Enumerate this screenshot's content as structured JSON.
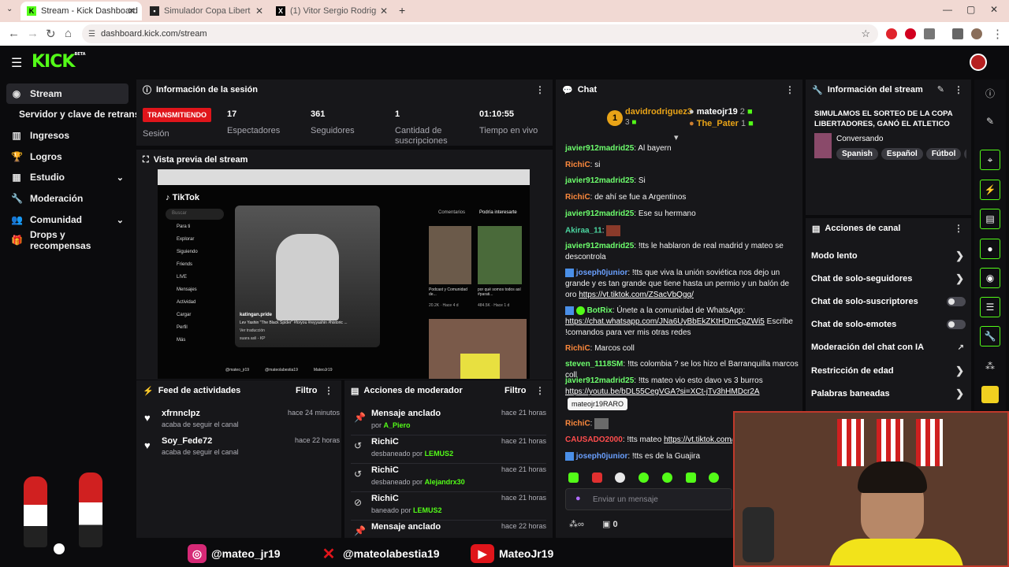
{
  "browser": {
    "tabs": [
      {
        "title": "Stream - Kick Dashboard",
        "active": true
      },
      {
        "title": "Simulador Copa Libertadores 2...",
        "active": false
      },
      {
        "title": "(1) Vitor Sergio Rodrigues VSR...",
        "active": false
      }
    ],
    "url": "dashboard.kick.com/stream"
  },
  "brand": {
    "logo": "KICK",
    "beta": "BETA",
    "accent": "#53fc18"
  },
  "sidebar": {
    "items": [
      {
        "label": "Stream",
        "icon": "broadcast-icon"
      },
      {
        "label": "Servidor y clave de retransm",
        "icon": ""
      },
      {
        "label": "Ingresos",
        "icon": "chart-icon"
      },
      {
        "label": "Logros",
        "icon": "trophy-icon"
      },
      {
        "label": "Estudio",
        "icon": "grid-icon"
      },
      {
        "label": "Moderación",
        "icon": "wrench-icon"
      },
      {
        "label": "Comunidad",
        "icon": "people-icon"
      },
      {
        "label": "Drops y recompensas",
        "icon": "gift-icon"
      }
    ]
  },
  "session": {
    "title": "Información de la sesión",
    "badge": "TRANSMITIENDO",
    "badge_label": "Sesión",
    "stats": [
      {
        "value": "17",
        "label": "Espectadores"
      },
      {
        "value": "361",
        "label": "Seguidores"
      },
      {
        "value": "1",
        "label": "Cantidad de suscripciones"
      },
      {
        "value": "01:10:55",
        "label": "Tiempo en vivo"
      }
    ]
  },
  "preview": {
    "title": "Vista previa del stream",
    "tiktok_brand": "TikTok",
    "tiktok_search": "Buscar",
    "tiktok_menu": [
      "Para ti",
      "Explorar",
      "Siguiendo",
      "Friends",
      "LIVE",
      "Mensajes",
      "Actividad",
      "Cargar",
      "Perfil",
      "Más"
    ],
    "tiktok_tabs": [
      "Comentarios",
      "Podría interesarte"
    ],
    "video_user": "katingan.pride",
    "video_caption": "Lev Yashin \"The Black Spider\" #foryou #reyyashin #historic ...",
    "video_translate": "Ver traducción",
    "video_sound": "suara asli - KP",
    "cards": [
      {
        "caption": "Podcast y Comunidad de...",
        "meta": "20.2K · Hace 4 d"
      },
      {
        "caption": "por qué somos todos así #parati...",
        "meta": "484.5K · Hace 1 d"
      }
    ],
    "overlay_handles": [
      "@mateo_jr19",
      "@mateolabestia19",
      "MateoJr19"
    ]
  },
  "feed": {
    "title": "Feed de actividades",
    "filter": "Filtro",
    "items": [
      {
        "user": "xfrnnclpz",
        "action": "acaba de seguir el canal",
        "time": "hace 24 minutos"
      },
      {
        "user": "Soy_Fede72",
        "action": "acaba de seguir el canal",
        "time": "hace 22 horas"
      }
    ]
  },
  "modactions": {
    "title": "Acciones de moderador",
    "filter": "Filtro",
    "items": [
      {
        "title": "Mensaje anclado",
        "prefix": "por ",
        "by": "A_Piero",
        "suffix": "",
        "time": "hace 21 horas",
        "icon": "pin-icon"
      },
      {
        "title": "RichiC",
        "prefix": "desbaneado por ",
        "by": "LEMUS2",
        "suffix": "",
        "time": "hace 21 horas",
        "icon": "undo-icon"
      },
      {
        "title": "RichiC",
        "prefix": "desbaneado por ",
        "by": "Alejandrx30",
        "suffix": "",
        "time": "hace 21 horas",
        "icon": "undo-icon"
      },
      {
        "title": "RichiC",
        "prefix": "baneado por ",
        "by": "LEMUS2",
        "suffix": "",
        "time": "hace 21 horas",
        "icon": "ban-icon"
      },
      {
        "title": "Mensaje anclado",
        "prefix": "",
        "by": "",
        "suffix": "",
        "time": "hace 22 horas",
        "icon": "pin-icon"
      }
    ]
  },
  "chat": {
    "title": "Chat",
    "top_gifters": [
      {
        "name": "davidrodriguez3",
        "count": "3",
        "rank": "1"
      },
      {
        "name": "mateojr19",
        "count": "2"
      },
      {
        "name": "The_Pater",
        "count": "1"
      }
    ],
    "messages": [
      {
        "user": "javier912madrid25",
        "text": ": Al bayern",
        "link": ""
      },
      {
        "user": "RichiC",
        "text": ": si",
        "link": ""
      },
      {
        "user": "javier912madrid25",
        "text": ": Si",
        "link": ""
      },
      {
        "user": "RichiC",
        "text": ": de ahí se fue a Argentinos",
        "link": ""
      },
      {
        "user": "javier912madrid25",
        "text": ": Ese su hermano",
        "link": ""
      },
      {
        "user": "Akiraa_11",
        "text": ":",
        "link": ""
      },
      {
        "user": "javier912madrid25",
        "text": ": !tts le hablaron de real madrid y mateo se descontrola",
        "link": ""
      },
      {
        "user": "joseph0junior",
        "text": ": !tts que viva la unión soviética nos dejo un grande y es tan grande que tiene hasta un permio y un balón de oro",
        "link": "https://vt.tiktok.com/ZSacVbQgq/"
      },
      {
        "user": "BotRix",
        "text": ": Únete a la comunidad de WhatsApp:",
        "link": "https://chat.whatsapp.com/JNa6UyBbEkZKtHDmCpZWi5",
        "after": " Escribe !comandos para ver mis otras redes"
      },
      {
        "user": "RichiC",
        "text": ": Marcos coll",
        "link": ""
      },
      {
        "user": "steven_1118SM",
        "text": ": !tts colombia ? se los hizo el Barranquilla marcos coll",
        "link": ""
      },
      {
        "user": "javier912madrid25",
        "text": ": !tts mateo vio esto davo vs 3 burros",
        "link": "https://youtu.be/bDL55CegVGA?si=XCt-jTv3hHMDcr2A"
      },
      {
        "user": "RichiC",
        "text": ":",
        "link": ""
      },
      {
        "user": "CAUSADO2000",
        "text": ": !tts mateo",
        "link": "https://vt.tiktok.com/ZS..."
      },
      {
        "user": "joseph0junior",
        "text": ": !tts es de la Guajira",
        "link": ""
      }
    ],
    "tooltip": "mateojr19RARO",
    "input_placeholder": "Enviar un mensaje",
    "footer_count": "0"
  },
  "streaminfo": {
    "title": "Información del stream",
    "stream_title": "SIMULAMOS EL SORTEO DE LA COPA LIBERTADORES, GANÓ EL ATLETICO DE...",
    "category": "Conversando",
    "tags": [
      "Spanish",
      "Español",
      "Fútbol",
      "ba"
    ]
  },
  "channel_actions": {
    "title": "Acciones de canal",
    "items": [
      {
        "label": "Modo lento",
        "control": "arrow"
      },
      {
        "label": "Chat de solo-seguidores",
        "control": "arrow"
      },
      {
        "label": "Chat de solo-suscriptores",
        "control": "toggle"
      },
      {
        "label": "Chat de solo-emotes",
        "control": "toggle"
      },
      {
        "label": "Moderación del chat con IA",
        "control": "external"
      },
      {
        "label": "Restricción de edad",
        "control": "arrow"
      },
      {
        "label": "Palabras baneadas",
        "control": "arrow"
      }
    ]
  }
}
